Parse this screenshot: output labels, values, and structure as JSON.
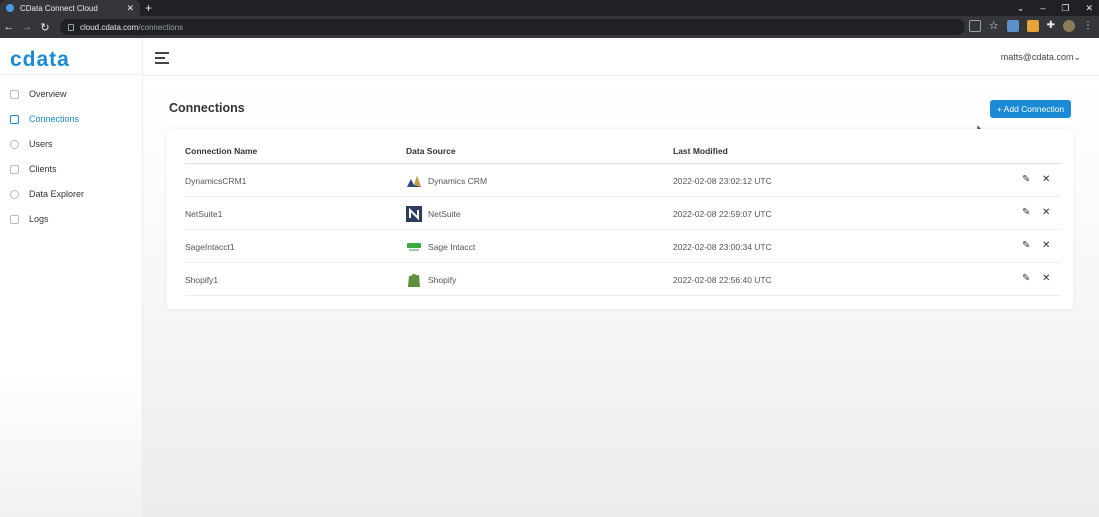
{
  "browser": {
    "tab_title": "CData Connect Cloud",
    "tab_close": "✕",
    "new_tab": "+",
    "url_host": "cloud.cdata.com",
    "url_path": "/connections",
    "win_minimize": "–",
    "win_restore": "❐",
    "win_close": "✕"
  },
  "app": {
    "logo": "cdata",
    "user_email": "matts@cdata.com",
    "user_chevron": "⌄",
    "accent_color": "#1a8ad6"
  },
  "sidebar": {
    "items": [
      {
        "label": "Overview",
        "icon": "activity-icon"
      },
      {
        "label": "Connections",
        "icon": "database-icon",
        "active": true
      },
      {
        "label": "Users",
        "icon": "user-icon"
      },
      {
        "label": "Clients",
        "icon": "link-icon"
      },
      {
        "label": "Data Explorer",
        "icon": "search-icon"
      },
      {
        "label": "Logs",
        "icon": "document-icon"
      }
    ]
  },
  "main": {
    "title": "Connections",
    "add_button": "+ Add Connection",
    "columns": [
      "Connection Name",
      "Data Source",
      "Last Modified"
    ],
    "rows": [
      {
        "name": "DynamicsCRM1",
        "source": "Dynamics CRM",
        "modified": "2022-02-08 23:02:12 UTC"
      },
      {
        "name": "NetSuite1",
        "source": "NetSuite",
        "modified": "2022-02-08 22:59:07 UTC"
      },
      {
        "name": "SageIntacct1",
        "source": "Sage Intacct",
        "modified": "2022-02-08 23:00:34 UTC"
      },
      {
        "name": "Shopify1",
        "source": "Shopify",
        "modified": "2022-02-08 22:56:40 UTC"
      }
    ],
    "edit_glyph": "✎",
    "delete_glyph": "✕"
  }
}
